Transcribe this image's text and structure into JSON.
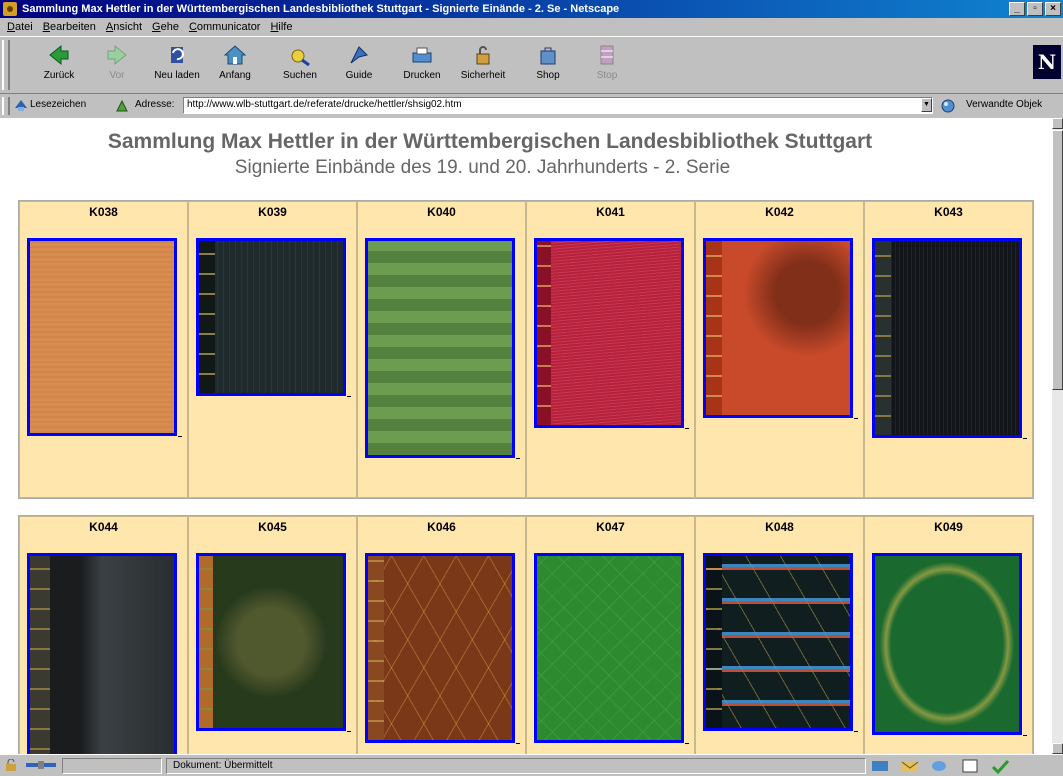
{
  "window": {
    "title": "Sammlung Max Hettler in der Württembergischen Landesbibliothek Stuttgart - Signierte Einände - 2. Se - Netscape",
    "controls": [
      "_",
      "▫",
      "×"
    ]
  },
  "menu": [
    "Datei",
    "Bearbeiten",
    "Ansicht",
    "Gehe",
    "Communicator",
    "Hilfe"
  ],
  "toolbar": {
    "back": "Zurück",
    "forward": "Vor",
    "reload": "Neu laden",
    "home": "Anfang",
    "search": "Suchen",
    "guide": "Guide",
    "print": "Drucken",
    "security": "Sicherheit",
    "shop": "Shop",
    "stop": "Stop",
    "logo": "N"
  },
  "location": {
    "bookmarks": "Lesezeichen",
    "address_label": "Adresse:",
    "url": "http://www.wlb-stuttgart.de/referate/drucke/hettler/shsig02.htm",
    "related": "Verwandte Objek"
  },
  "page": {
    "title": "Sammlung Max Hettler in der Württembergischen Landesbibliothek Stuttgart",
    "subtitle": "Signierte Einbände des 19. und 20. Jahrhunderts - 2. Serie"
  },
  "rows": [
    [
      {
        "id": "K038",
        "color": "#d98c4e",
        "spine": "#c07838"
      },
      {
        "id": "K039",
        "color": "#1e2a2c",
        "spine": "#101818"
      },
      {
        "id": "K040",
        "color": "#6c9c50",
        "spine": "#5a8840"
      },
      {
        "id": "K041",
        "color": "#b8203c",
        "spine": "#8a1028"
      },
      {
        "id": "K042",
        "color": "#c84a2a",
        "spine": "#a83418"
      },
      {
        "id": "K043",
        "color": "#12161a",
        "spine": "#283030"
      }
    ],
    [
      {
        "id": "K044",
        "color": "#222628",
        "spine": "#3a3a30"
      },
      {
        "id": "K045",
        "color": "#283a1c",
        "spine": "#b06a2a"
      },
      {
        "id": "K046",
        "color": "#7a3818",
        "spine": "#8a4820"
      },
      {
        "id": "K047",
        "color": "#2e8a2e",
        "spine": "#267826"
      },
      {
        "id": "K048",
        "color": "#101e20",
        "spine": "#0a1418"
      },
      {
        "id": "K049",
        "color": "#1a6a30",
        "spine": "#1a6a30"
      }
    ]
  ],
  "status": {
    "text": "Dokument: Übermittelt"
  }
}
